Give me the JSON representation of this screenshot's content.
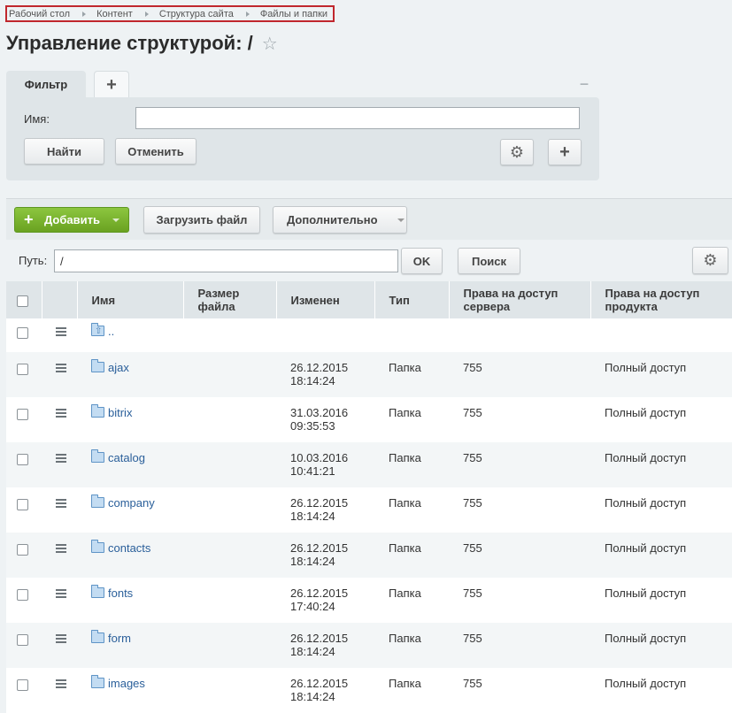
{
  "breadcrumb": [
    "Рабочий стол",
    "Контент",
    "Структура сайта",
    "Файлы и папки"
  ],
  "page": {
    "title": "Управление структурой: /"
  },
  "filter": {
    "tab_label": "Фильтр",
    "add_tab": "+",
    "collapse": "−",
    "name_label": "Имя:",
    "name_value": "",
    "find_label": "Найти",
    "cancel_label": "Отменить"
  },
  "toolbar": {
    "add_label": "Добавить",
    "upload_label": "Загрузить файл",
    "more_label": "Дополнительно"
  },
  "pathbar": {
    "label": "Путь:",
    "value": "/",
    "ok_label": "OK",
    "search_label": "Поиск"
  },
  "table": {
    "columns": {
      "name": "Имя",
      "size": "Размер файла",
      "modified": "Изменен",
      "type": "Тип",
      "server_rights": "Права на доступ сервера",
      "product_rights": "Права на доступ продукта"
    },
    "parent_label": "..",
    "rows": [
      {
        "name": "ajax",
        "date": "26.12.2015",
        "time": "18:14:24",
        "type": "Папка",
        "server": "755",
        "product": "Полный доступ"
      },
      {
        "name": "bitrix",
        "date": "31.03.2016",
        "time": "09:35:53",
        "type": "Папка",
        "server": "755",
        "product": "Полный доступ"
      },
      {
        "name": "catalog",
        "date": "10.03.2016",
        "time": "10:41:21",
        "type": "Папка",
        "server": "755",
        "product": "Полный доступ"
      },
      {
        "name": "company",
        "date": "26.12.2015",
        "time": "18:14:24",
        "type": "Папка",
        "server": "755",
        "product": "Полный доступ"
      },
      {
        "name": "contacts",
        "date": "26.12.2015",
        "time": "18:14:24",
        "type": "Папка",
        "server": "755",
        "product": "Полный доступ"
      },
      {
        "name": "fonts",
        "date": "26.12.2015",
        "time": "17:40:24",
        "type": "Папка",
        "server": "755",
        "product": "Полный доступ"
      },
      {
        "name": "form",
        "date": "26.12.2015",
        "time": "18:14:24",
        "type": "Папка",
        "server": "755",
        "product": "Полный доступ"
      },
      {
        "name": "images",
        "date": "26.12.2015",
        "time": "18:14:24",
        "type": "Папка",
        "server": "755",
        "product": "Полный доступ"
      }
    ]
  }
}
